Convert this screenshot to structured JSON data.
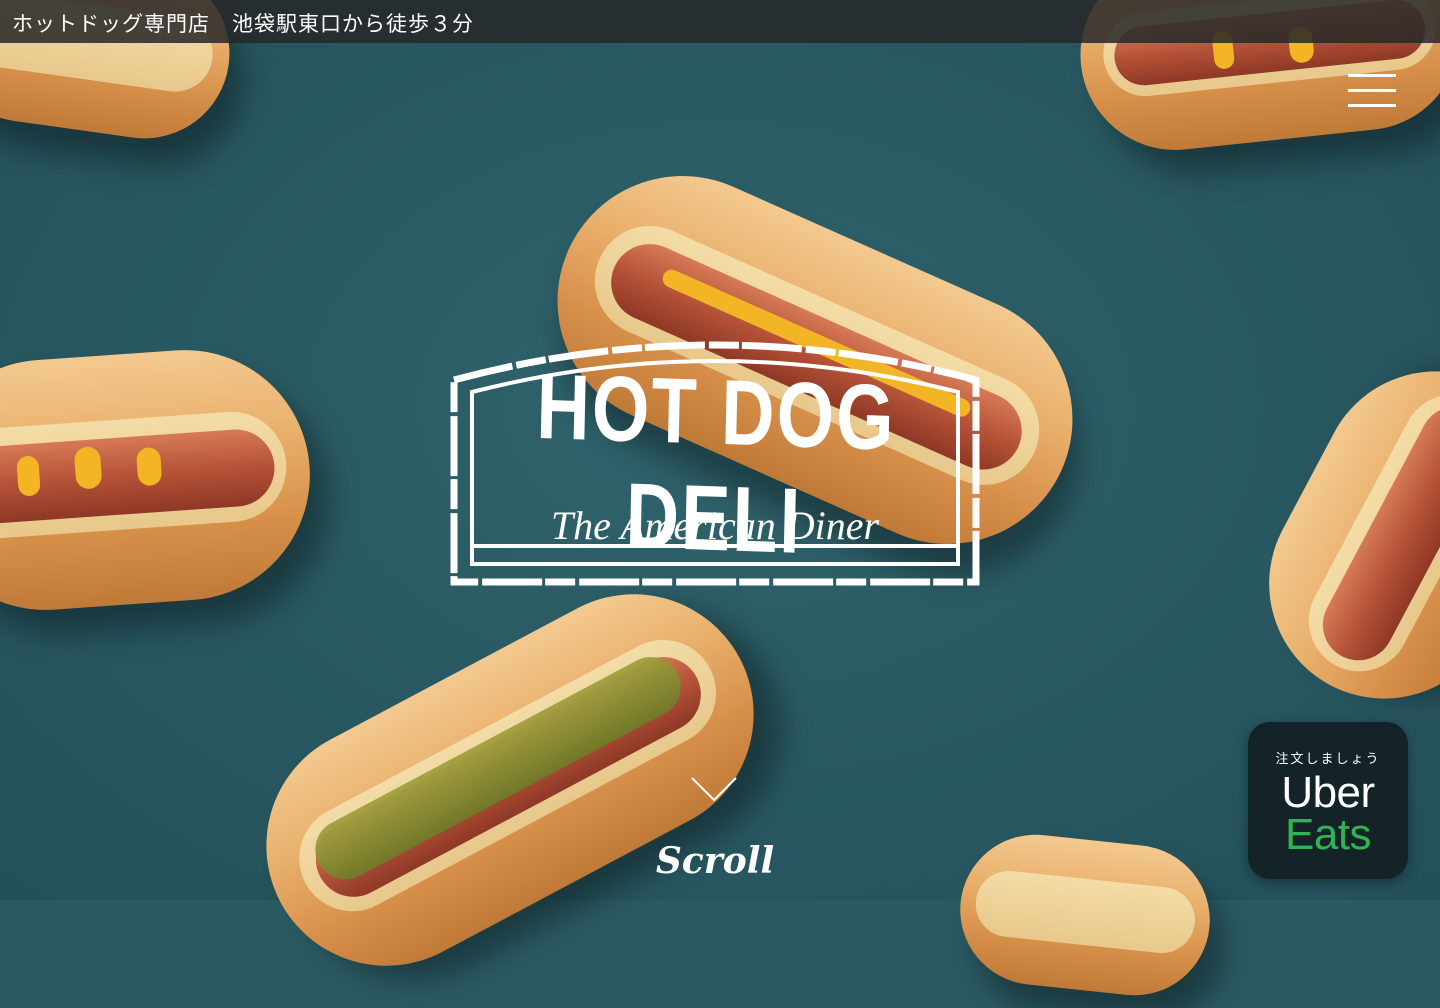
{
  "header": {
    "text": "ホットドッグ専門店　池袋駅東口から徒歩３分"
  },
  "logo": {
    "title": "HOT DOG DELI",
    "subtitle": "The American Diner"
  },
  "scroll": {
    "label": "Scroll",
    "icon": "chevron-down-icon"
  },
  "menu": {
    "icon": "hamburger-menu-icon"
  },
  "uber_eats": {
    "order_text": "注文しましょう",
    "brand_line1": "Uber",
    "brand_line2": "Eats",
    "brand_green": "#2fb355",
    "background": "#142328"
  },
  "colors": {
    "background": "#2b5a63",
    "header_bar": "#282828",
    "text": "#ffffff"
  }
}
